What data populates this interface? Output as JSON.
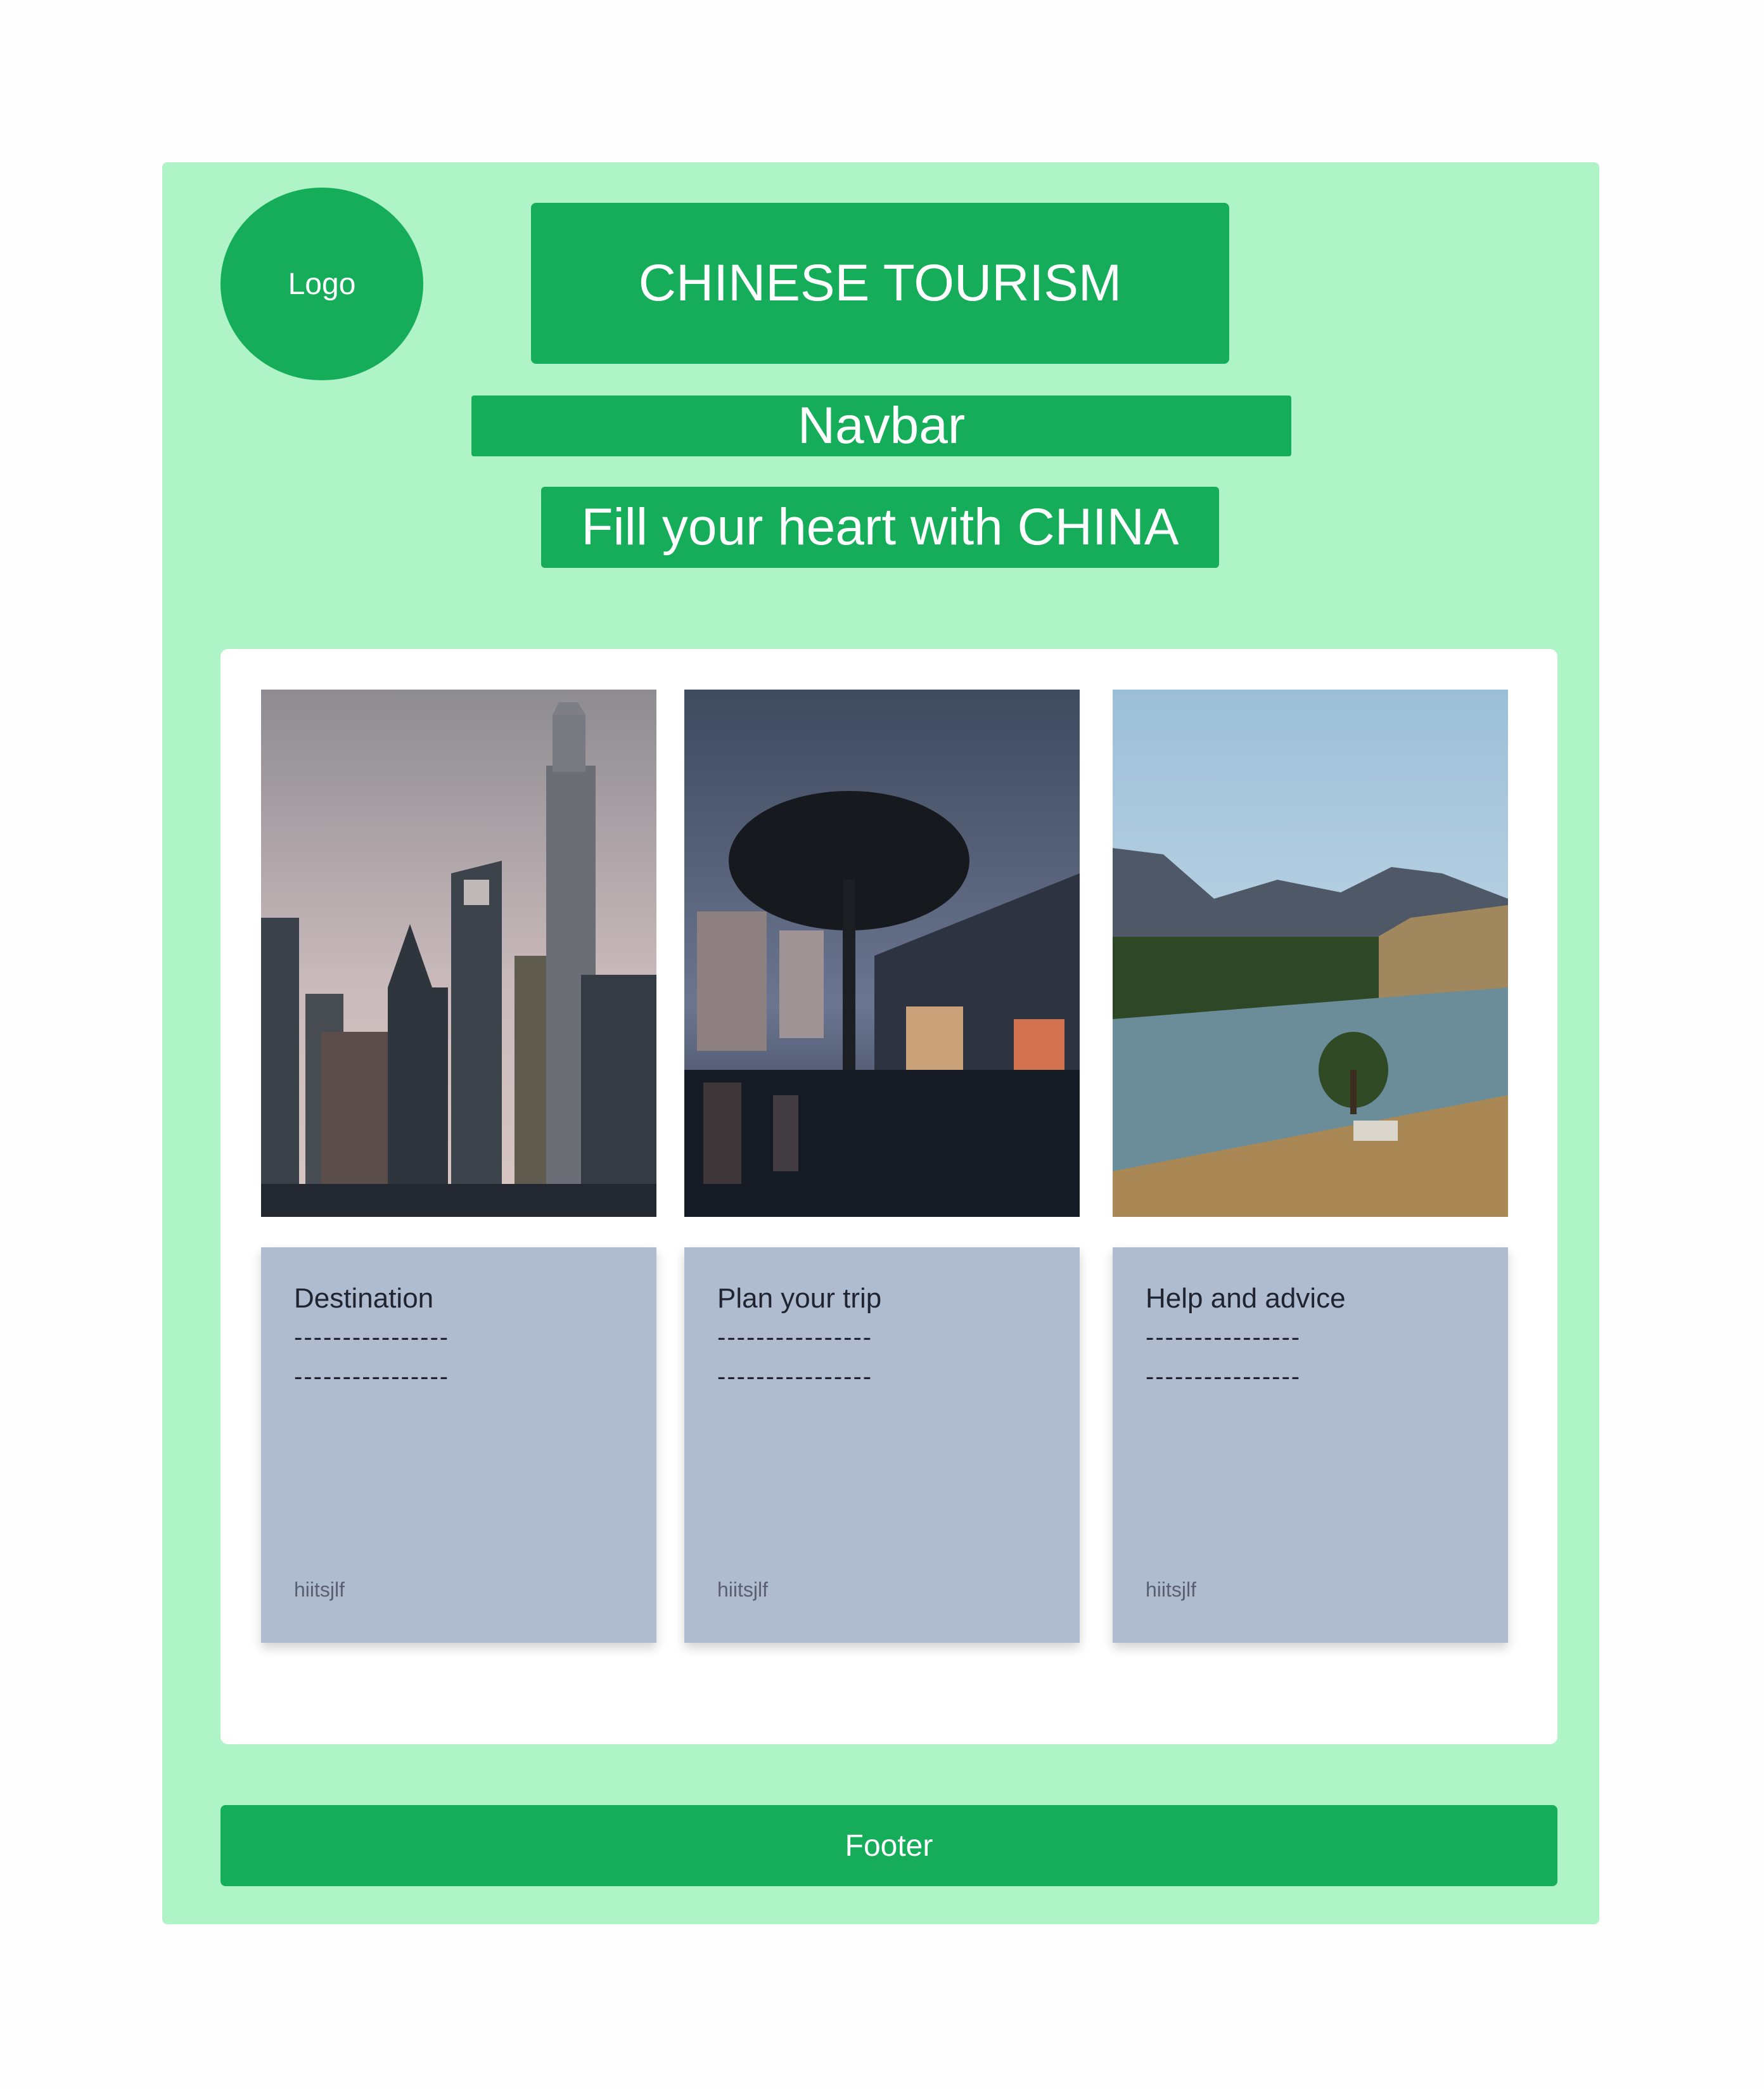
{
  "header": {
    "logo_text": "Logo",
    "site_title": "CHINESE TOURISM",
    "navbar_text": "Navbar",
    "tagline": "Fill your heart with CHINA"
  },
  "photos": [
    {
      "icon": "city-skyline-photo"
    },
    {
      "icon": "canal-town-night-photo"
    },
    {
      "icon": "mountain-river-photo"
    }
  ],
  "cards": [
    {
      "title": "Destination",
      "line1": "----------------",
      "line2": "----------------",
      "author": "hiitsjlf"
    },
    {
      "title": "Plan your trip",
      "line1": "----------------",
      "line2": "----------------",
      "author": "hiitsjlf"
    },
    {
      "title": "Help and advice",
      "line1": "----------------",
      "line2": "----------------",
      "author": "hiitsjlf"
    }
  ],
  "footer": {
    "text": "Footer"
  },
  "colors": {
    "page_bg": "#aff4c6",
    "accent_green": "#16ad5a",
    "card_bg": "#afbcd0",
    "panel_bg": "#ffffff"
  }
}
